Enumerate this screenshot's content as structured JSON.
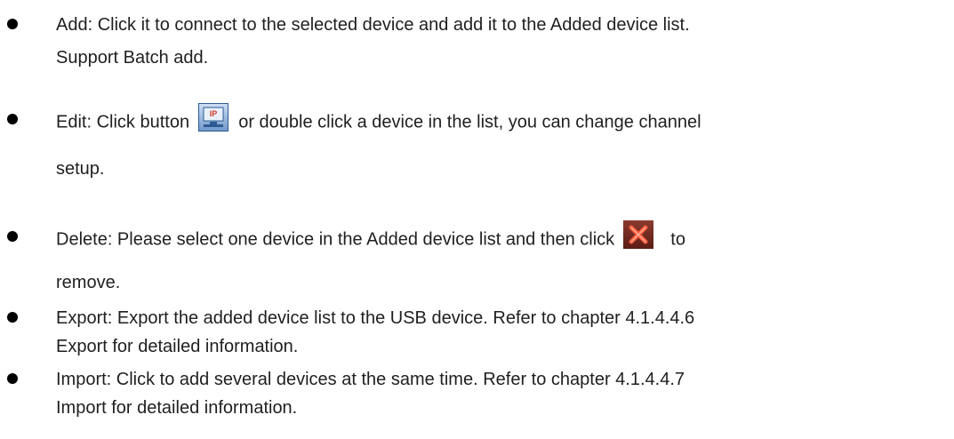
{
  "items": [
    {
      "line1": "Add: Click it to connect to the selected device and add it to the Added device list.",
      "line2": "Support Batch add."
    },
    {
      "line1_before": "Edit: Click button",
      "line1_after": "or double click a device in the list, you can change channel",
      "line2": "setup.",
      "icon": "ip-edit-icon"
    },
    {
      "line1_before": "Delete: Please select one device in the Added device list and then click",
      "line1_after": "to",
      "line2": "remove.",
      "icon": "delete-x-icon"
    },
    {
      "line1": "Export: Export the added device list to the USB device. Refer to chapter 4.1.4.4.6",
      "line2": "Export for detailed information."
    },
    {
      "line1": "Import: Click to add several devices at the same time. Refer to chapter 4.1.4.4.7",
      "line2": "Import for detailed information."
    }
  ],
  "colors": {
    "text": "#1f1f1f",
    "icon_blue": "#3a6fb0",
    "icon_red": "#c0392b"
  }
}
